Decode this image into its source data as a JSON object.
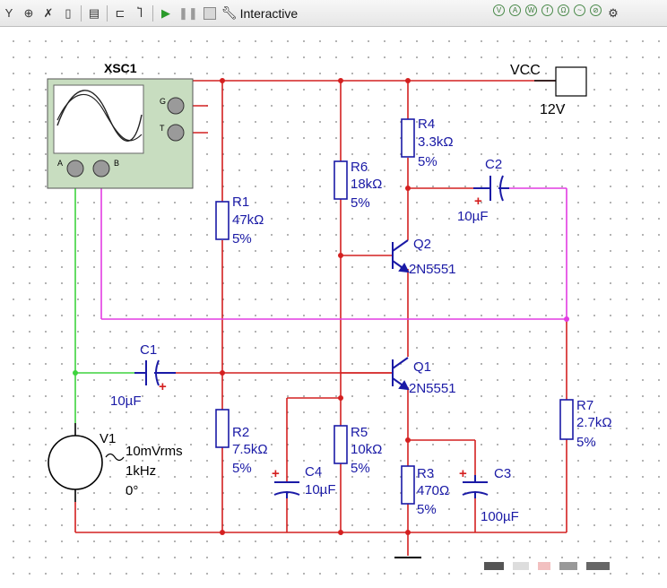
{
  "toolbar": {
    "icons": [
      "probe-icon",
      "meter-icon",
      "tool-icon",
      "component-icon",
      "pin-icon",
      "wire-icon",
      "step-icon"
    ],
    "mode_label": "Interactive",
    "right_icons": [
      "sim-icon-1",
      "sim-icon-2",
      "sim-icon-3",
      "sim-icon-4",
      "sim-icon-5",
      "sim-icon-6",
      "sim-icon-7",
      "gear-icon"
    ]
  },
  "colors": {
    "wire_red": "#d42020",
    "wire_green": "#3ed43e",
    "wire_magenta": "#e23ce2",
    "part_blue": "#1a1aa6",
    "scope_fill": "#c8ddc0"
  },
  "schematic": {
    "oscilloscope": {
      "name": "XSC1",
      "pin_g": "G",
      "pin_t": "T",
      "pin_a": "A",
      "pin_b": "B"
    },
    "vcc": {
      "label": "VCC",
      "voltage": "12V"
    },
    "components": {
      "r1": {
        "ref": "R1",
        "value": "47kΩ",
        "tol": "5%"
      },
      "r2": {
        "ref": "R2",
        "value": "7.5kΩ",
        "tol": "5%"
      },
      "r3": {
        "ref": "R3",
        "value": "470Ω",
        "tol": "5%"
      },
      "r4": {
        "ref": "R4",
        "value": "3.3kΩ",
        "tol": "5%"
      },
      "r5": {
        "ref": "R5",
        "value": "10kΩ",
        "tol": "5%"
      },
      "r6": {
        "ref": "R6",
        "value": "18kΩ",
        "tol": "5%"
      },
      "r7": {
        "ref": "R7",
        "value": "2.7kΩ",
        "tol": "5%"
      },
      "c1": {
        "ref": "C1",
        "value": "10µF"
      },
      "c2": {
        "ref": "C2",
        "value": "10µF"
      },
      "c3": {
        "ref": "C3",
        "value": "100µF"
      },
      "c4": {
        "ref": "C4",
        "value": "10µF"
      },
      "q1": {
        "ref": "Q1",
        "model": "2N5551"
      },
      "q2": {
        "ref": "Q2",
        "model": "2N5551"
      },
      "v1": {
        "ref": "V1",
        "amplitude": "10mVrms",
        "frequency": "1kHz",
        "phase": "0°"
      }
    }
  }
}
